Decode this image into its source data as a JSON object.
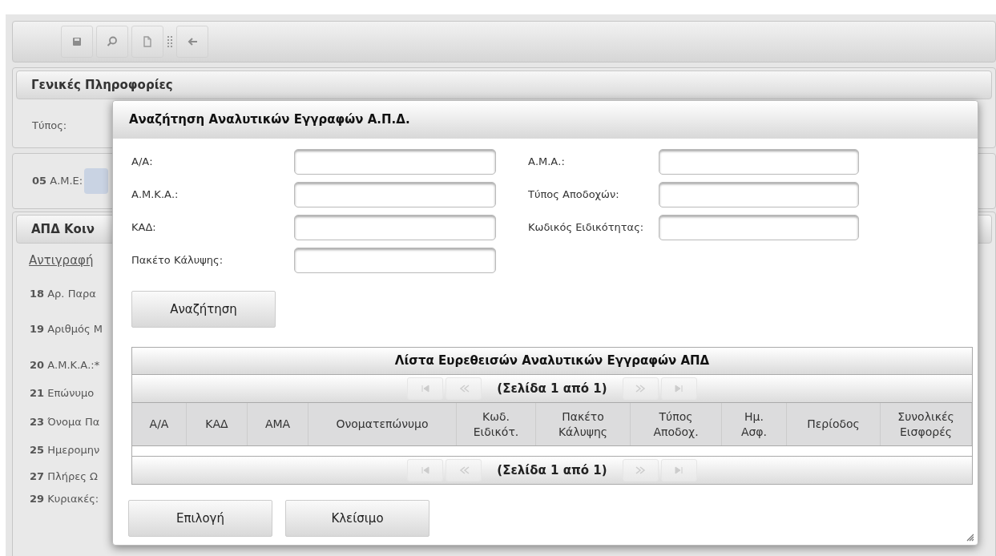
{
  "toolbar": {
    "buttons": [
      {
        "kind": "save",
        "disabled": true
      },
      {
        "kind": "search",
        "disabled": true
      },
      {
        "kind": "new",
        "disabled": true
      },
      {
        "kind": "grip"
      },
      {
        "kind": "back",
        "disabled": true
      }
    ]
  },
  "background": {
    "general_panel": {
      "title": "Γενικές Πληροφορίες",
      "type_label": "Τύπος:"
    },
    "ame_panel": {
      "number": "05",
      "label": "Α.Μ.Ε:"
    },
    "apd_panel": {
      "title": "ΑΠΔ Κοιν",
      "link": "Αντιγραφή",
      "rows": [
        {
          "number": "18",
          "label": "Αρ. Παρα"
        },
        {
          "number": "19",
          "label": "Αριθμός Μ"
        },
        {
          "number": "20",
          "label": "Α.Μ.Κ.Α.:*"
        },
        {
          "number": "21",
          "label": "Επώνυμο"
        },
        {
          "number": "23",
          "label": "Όνομα Πα"
        },
        {
          "number": "25",
          "label": "Ημερομην"
        },
        {
          "number": "27",
          "label": "Πλήρες Ω"
        },
        {
          "number": "29",
          "label": "Κυριακές:"
        }
      ]
    }
  },
  "dialog": {
    "title": "Αναζήτηση Αναλυτικών Εγγραφών Α.Π.Δ.",
    "left_fields": [
      {
        "label": "Α/Α:"
      },
      {
        "label": "Α.Μ.Κ.Α.:"
      },
      {
        "label": "ΚΑΔ:"
      },
      {
        "label": "Πακέτο Κάλυψης:"
      }
    ],
    "right_fields": [
      {
        "label": "Α.Μ.Α.:"
      },
      {
        "label": "Τύπος Αποδοχών:"
      },
      {
        "label": "Κωδικός Ειδικότητας:"
      }
    ],
    "search_button": "Αναζήτηση",
    "table": {
      "title": "Λίστα Ευρεθεισών Αναλυτικών Εγγραφών ΑΠΔ",
      "top_pager": {
        "label": "(Σελίδα 1 από 1)",
        "first_disabled": true,
        "prev_disabled": true,
        "next_disabled": true,
        "last_disabled": true
      },
      "columns": [
        "Α/Α",
        "ΚΑΔ",
        "ΑΜΑ",
        "Ονοματεπώνυμο",
        "Κωδ.\nΕιδικότ.",
        "Πακέτο\nΚάλυψης",
        "Τύπος\nΑποδοχ.",
        "Ημ.\nΑσφ.",
        "Περίοδος",
        "Συνολικές\nΕισφορές"
      ],
      "bottom_pager": {
        "label": "(Σελίδα 1 από 1)",
        "first_disabled": true,
        "prev_disabled": true,
        "next_disabled": true,
        "last_disabled": true
      }
    },
    "buttons": [
      "Επιλογή",
      "Κλείσιμο"
    ]
  }
}
